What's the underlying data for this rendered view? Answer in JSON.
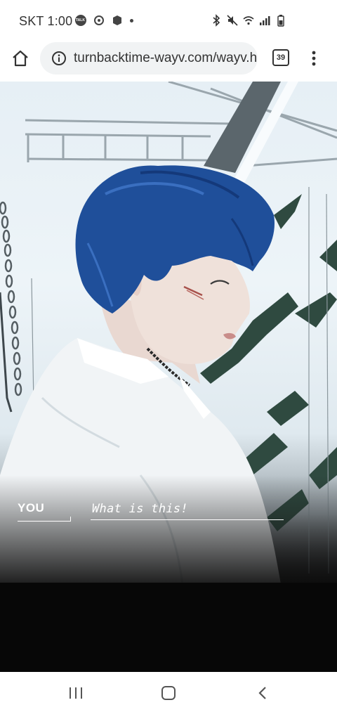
{
  "status_bar": {
    "carrier_time": "SKT 1:00",
    "notification_icons": [
      "kakaotalk-icon",
      "app-icon",
      "app-icon",
      "dot-icon"
    ],
    "system_icons": [
      "bluetooth-icon",
      "mute-icon",
      "wifi-icon",
      "signal-icon",
      "battery-icon"
    ]
  },
  "browser": {
    "url": "turnbacktime-wayv.com/wayv.h",
    "tab_count": "39"
  },
  "story": {
    "speaker": "YOU",
    "dialogue": "What is this!"
  },
  "colors": {
    "hair_blue": "#1f4f9a",
    "text_white": "#ffffff",
    "bar_bg": "#f1f3f4"
  }
}
